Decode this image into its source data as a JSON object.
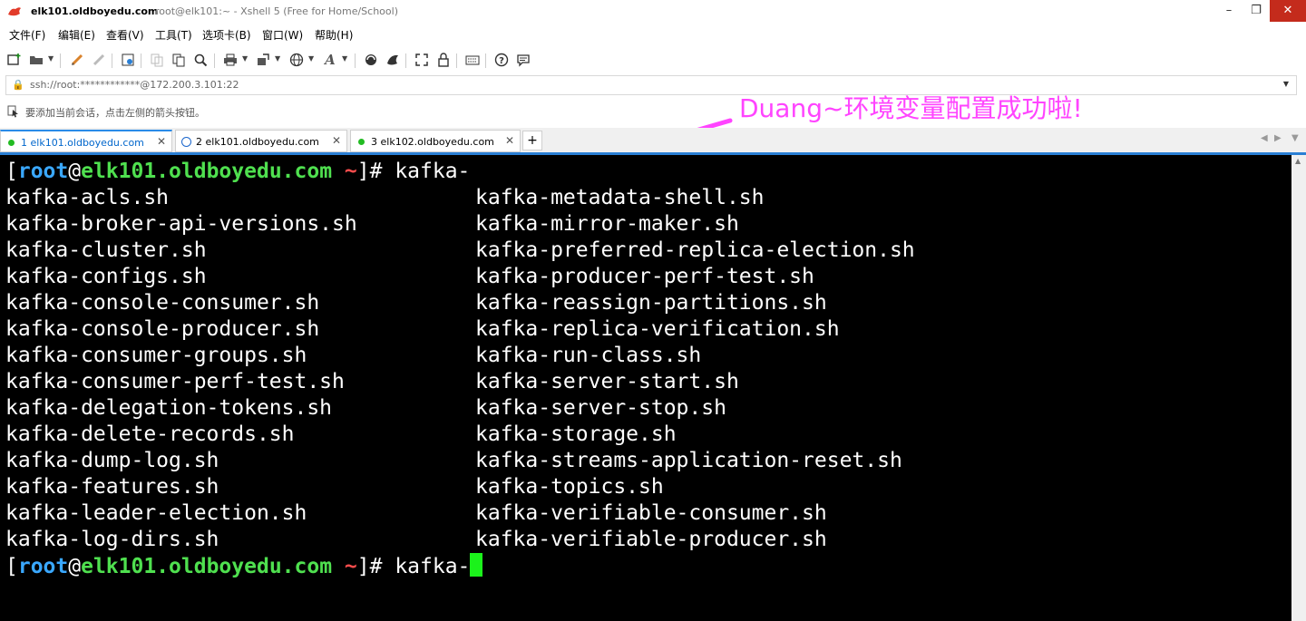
{
  "window": {
    "host_title": "elk101.oldboyedu.com",
    "rest_title": "root@elk101:~ - Xshell 5 (Free for Home/School)",
    "minimize": "–",
    "maximize": "❐",
    "close": "✕"
  },
  "menu": [
    "文件(F)",
    "编辑(E)",
    "查看(V)",
    "工具(T)",
    "选项卡(B)",
    "窗口(W)",
    "帮助(H)"
  ],
  "address": {
    "value": "ssh://root:************@172.200.3.101:22"
  },
  "hint": {
    "text": "要添加当前会话，点击左侧的箭头按钮。"
  },
  "annotation": {
    "text": "Duang~环境变量配置成功啦!",
    "color": "#ff44ff"
  },
  "tabs": [
    {
      "label": "1 elk101.oldboyedu.com",
      "status_color": "#22bb22",
      "active": true
    },
    {
      "label": "2 elk101.oldboyedu.com",
      "status_color": "#1a66cc",
      "active": false
    },
    {
      "label": "3 elk102.oldboyedu.com",
      "status_color": "#22bb22",
      "active": false
    }
  ],
  "tab_add": "+",
  "terminal": {
    "prompt": {
      "open": "[",
      "user": "root",
      "at": "@",
      "host": "elk101.oldboyedu.com",
      "path": " ~",
      "close": "]# "
    },
    "command1": "kafka-",
    "command2": "kafka-",
    "col1": [
      "kafka-acls.sh",
      "kafka-broker-api-versions.sh",
      "kafka-cluster.sh",
      "kafka-configs.sh",
      "kafka-console-consumer.sh",
      "kafka-console-producer.sh",
      "kafka-consumer-groups.sh",
      "kafka-consumer-perf-test.sh",
      "kafka-delegation-tokens.sh",
      "kafka-delete-records.sh",
      "kafka-dump-log.sh",
      "kafka-features.sh",
      "kafka-leader-election.sh",
      "kafka-log-dirs.sh"
    ],
    "col2": [
      "kafka-metadata-shell.sh",
      "kafka-mirror-maker.sh",
      "kafka-preferred-replica-election.sh",
      "kafka-producer-perf-test.sh",
      "kafka-reassign-partitions.sh",
      "kafka-replica-verification.sh",
      "kafka-run-class.sh",
      "kafka-server-start.sh",
      "kafka-server-stop.sh",
      "kafka-storage.sh",
      "kafka-streams-application-reset.sh",
      "kafka-topics.sh",
      "kafka-verifiable-consumer.sh",
      "kafka-verifiable-producer.sh"
    ]
  }
}
